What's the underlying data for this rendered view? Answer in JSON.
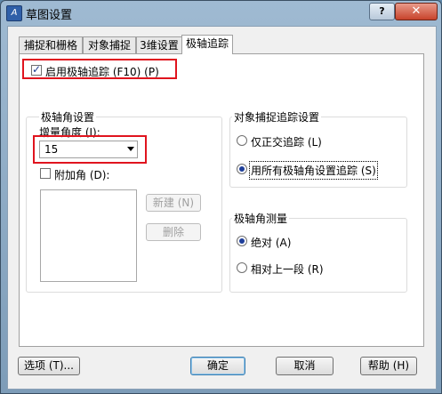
{
  "window": {
    "title": "草图设置",
    "help_btn": "?",
    "close_btn": "✕"
  },
  "tabs": [
    {
      "label": "捕捉和栅格",
      "active": false
    },
    {
      "label": "对象捕捉",
      "active": false
    },
    {
      "label": "3维设置",
      "active": false
    },
    {
      "label": "极轴追踪",
      "active": true
    }
  ],
  "polar": {
    "enable_label": "启用极轴追踪 (F10) (P)",
    "enable_checked": true,
    "settings_group": "极轴角设置",
    "increment_label": "增量角度 (I):",
    "increment_value": "15",
    "additional_label": "附加角 (D):",
    "additional_checked": false,
    "new_btn": "新建 (N)",
    "delete_btn": "删除"
  },
  "osnap": {
    "group": "对象捕捉追踪设置",
    "option_orthogonal": "仅正交追踪 (L)",
    "option_all": "用所有极轴角设置追踪 (S)",
    "selected": "all"
  },
  "measure": {
    "group": "极轴角测量",
    "option_absolute": "绝对 (A)",
    "option_relative": "相对上一段 (R)",
    "selected": "absolute"
  },
  "footer": {
    "options_btn": "选项 (T)...",
    "ok_btn": "确定",
    "cancel_btn": "取消",
    "help_btn": "帮助 (H)"
  },
  "colors": {
    "highlight": "#e0141e",
    "radio_dot": "#1f3f9a"
  }
}
